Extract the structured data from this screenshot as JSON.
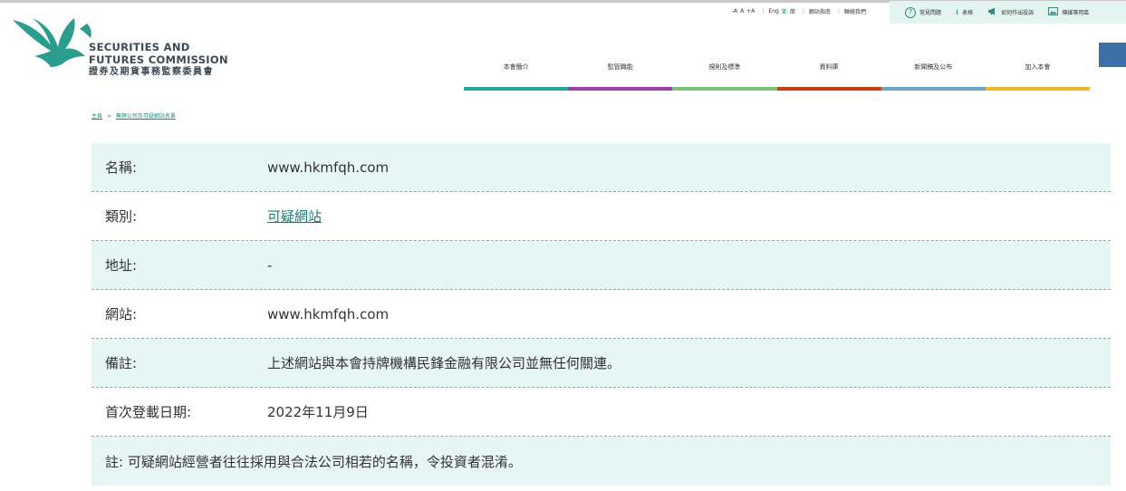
{
  "header": {
    "logo": {
      "name_en_line1": "SECURITIES AND",
      "name_en_line2": "FUTURES COMMISSION",
      "name_zh": "證券及期貨事務監察委員會",
      "color": "#2a9d8f"
    },
    "font_size": {
      "decrease": "-A",
      "normal": "A",
      "increase": "+A"
    },
    "languages": {
      "english": "Eng",
      "traditional": "繁",
      "simplified": "简"
    },
    "links": {
      "site_guide": "網站指南",
      "contact_us": "聯絡我們"
    },
    "quick_links": [
      {
        "label": "常見問題",
        "icon": "question-icon"
      },
      {
        "label": "表格",
        "icon": "download-icon"
      },
      {
        "label": "如何作出投訴",
        "icon": "megaphone-icon"
      },
      {
        "label": "傳媒專用區",
        "icon": "image-icon"
      }
    ]
  },
  "nav": {
    "items": [
      {
        "label": "本會簡介",
        "color": "#26a69a"
      },
      {
        "label": "監管職能",
        "color": "#9c3fa8"
      },
      {
        "label": "規則及標準",
        "color": "#7cc576"
      },
      {
        "label": "資料庫",
        "color": "#c2410c"
      },
      {
        "label": "新聞稿及公布",
        "color": "#6ea3c9"
      },
      {
        "label": "加入本會",
        "color": "#f0b429"
      }
    ]
  },
  "breadcrumb": {
    "home": "主頁",
    "separator": ">",
    "current": "無牌公司及可疑網站名單"
  },
  "detail": {
    "rows": [
      {
        "key": "名稱:",
        "value": "www.hkmfqh.com"
      },
      {
        "key": "類別:",
        "value": "可疑網站"
      },
      {
        "key": "地址:",
        "value": "-"
      },
      {
        "key": "網站:",
        "value": "www.hkmfqh.com"
      },
      {
        "key": "備註:",
        "value": "上述網站與本會持牌機構民鋒金融有限公司並無任何關連。"
      },
      {
        "key": "首次登載日期:",
        "value": "2022年11月9日"
      }
    ],
    "note": "註: 可疑網站經營者往往採用與合法公司相若的名稱，令投資者混淆。"
  }
}
